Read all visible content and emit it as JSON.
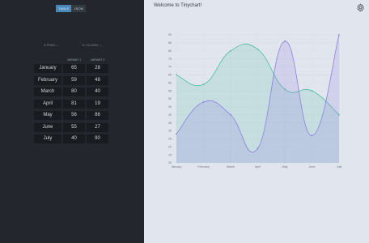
{
  "app": {
    "welcome": "Welcome to Tinychart!",
    "settings_icon": "gear-icon"
  },
  "view_toggle": {
    "table_label": "TABLE",
    "json_label": "JSON",
    "active": "TABLE"
  },
  "controls": {
    "rows_label": "ROWS",
    "columns_label": "COLUMNS",
    "rows_icon": "arrows-icon",
    "columns_icon": "arrows-icon"
  },
  "table": {
    "headers": [
      "",
      "VARIANT 1",
      "VARIANT 2"
    ],
    "rows": [
      [
        "January",
        "65",
        "28"
      ],
      [
        "February",
        "59",
        "48"
      ],
      [
        "March",
        "80",
        "40"
      ],
      [
        "April",
        "81",
        "19"
      ],
      [
        "May",
        "56",
        "86"
      ],
      [
        "June",
        "55",
        "27"
      ],
      [
        "July",
        "40",
        "90"
      ]
    ]
  },
  "colors": {
    "variant1": "#4bbf9e",
    "variant2": "#8f7fe0",
    "accent": "#4a88b8"
  },
  "chart_data": {
    "type": "line",
    "categories": [
      "January",
      "February",
      "March",
      "April",
      "May",
      "June",
      "July"
    ],
    "series": [
      {
        "values": [
          65,
          59,
          80,
          81,
          56,
          55,
          40
        ]
      },
      {
        "values": [
          28,
          48,
          40,
          19,
          86,
          27,
          90
        ]
      }
    ],
    "yticks": [
      "90",
      "85",
      "80",
      "75",
      "70",
      "65",
      "60",
      "55",
      "50",
      "45",
      "40",
      "35",
      "30",
      "25",
      "20",
      "15",
      "10"
    ],
    "ylim": [
      10,
      90
    ],
    "smooth": true,
    "filled": true,
    "grid": true,
    "legend": "none"
  }
}
